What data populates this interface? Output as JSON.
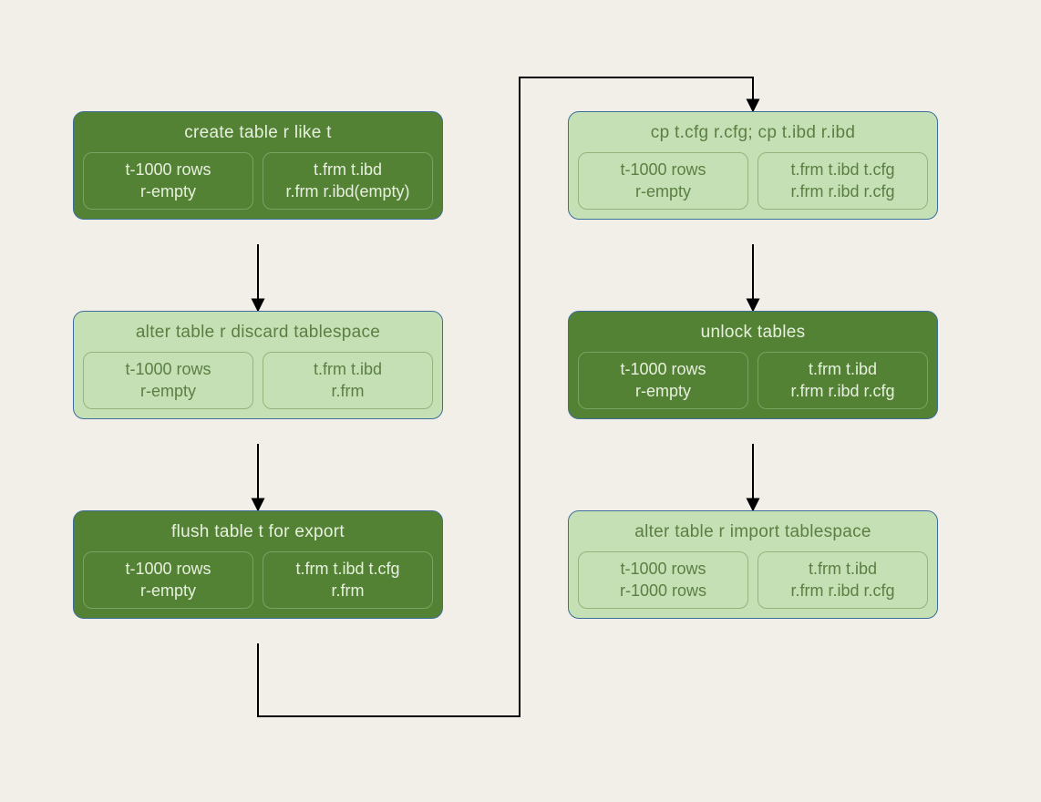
{
  "nodes": {
    "n1": {
      "title": "create table r like t",
      "left1": "t-1000 rows",
      "left2": "r-empty",
      "right1": "t.frm   t.ibd",
      "right2": "r.frm r.ibd(empty)"
    },
    "n2": {
      "title": "alter table r discard tablespace",
      "left1": "t-1000 rows",
      "left2": "r-empty",
      "right1": "t.frm t.ibd",
      "right2": "r.frm"
    },
    "n3": {
      "title": "flush table t for export",
      "left1": "t-1000 rows",
      "left2": "r-empty",
      "right1": "t.frm   t.ibd  t.cfg",
      "right2": "r.frm"
    },
    "n4": {
      "title": "cp t.cfg r.cfg; cp t.ibd r.ibd",
      "left1": "t-1000 rows",
      "left2": "r-empty",
      "right1": "t.frm  t.ibd  t.cfg",
      "right2": "r.frm  r.ibd  r.cfg"
    },
    "n5": {
      "title": "unlock tables",
      "left1": "t-1000 rows",
      "left2": "r-empty",
      "right1": "t.frm   t.ibd",
      "right2": "r.frm r.ibd  r.cfg"
    },
    "n6": {
      "title": "alter table r import tablespace",
      "left1": "t-1000 rows",
      "left2": "r-1000 rows",
      "right1": "t.frm  t.ibd",
      "right2": "r.frm  r.ibd  r.cfg"
    }
  }
}
